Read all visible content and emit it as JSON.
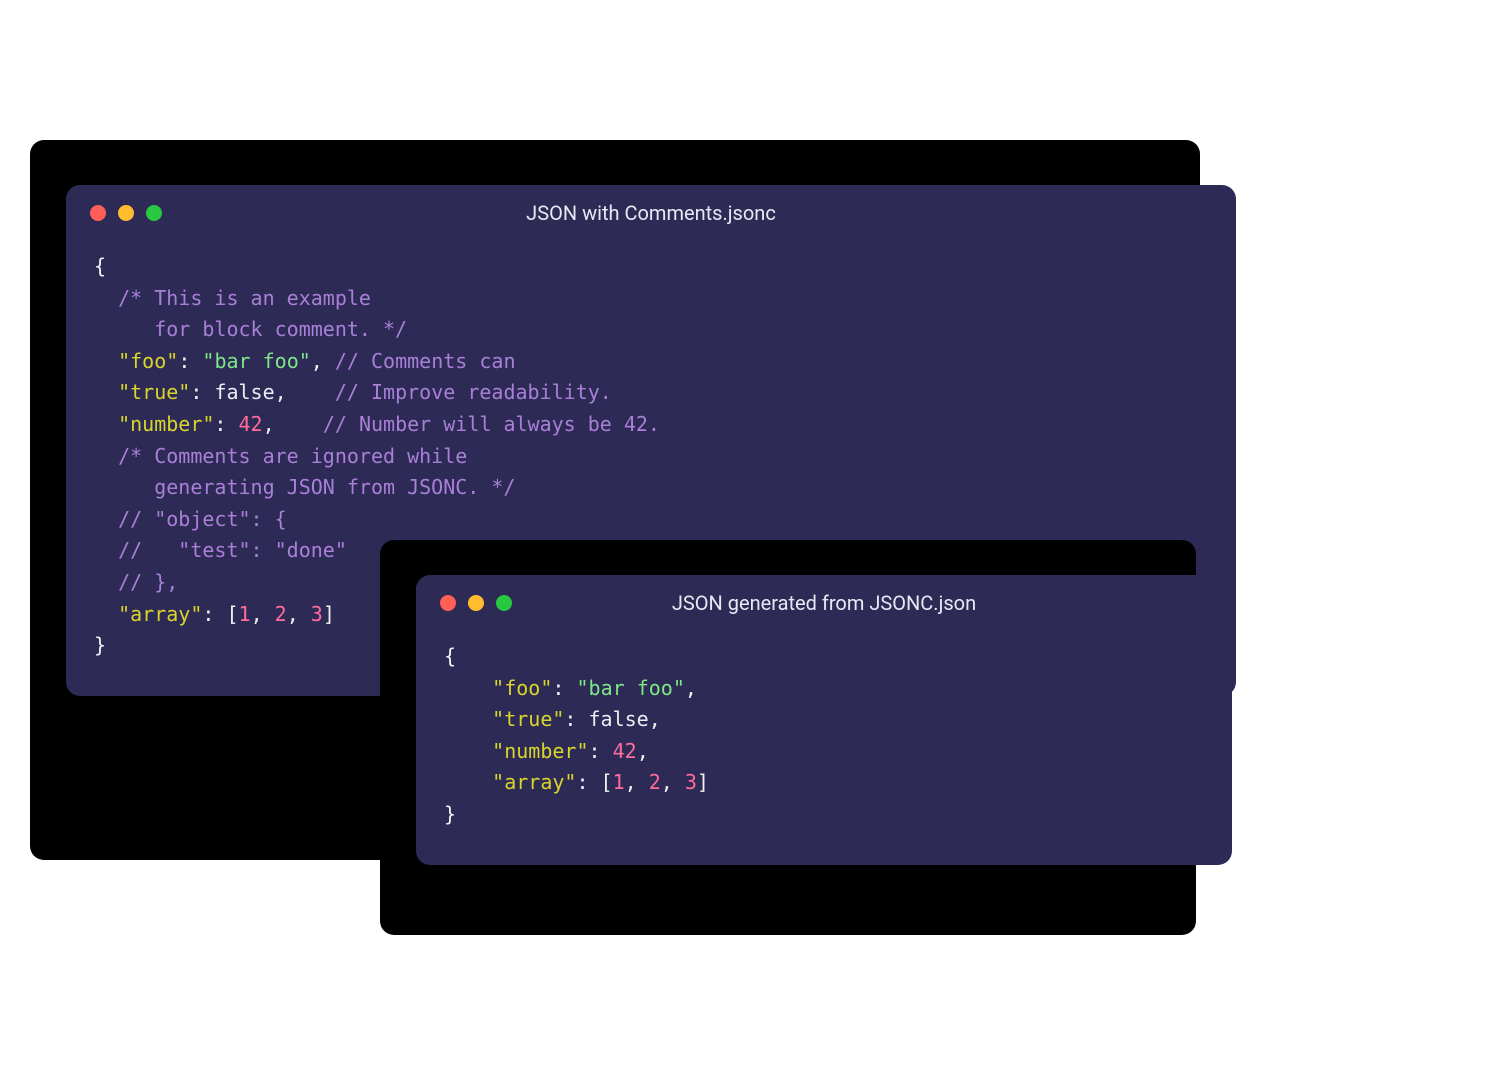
{
  "windows": {
    "front": {
      "title": "JSON with Comments.jsonc",
      "code": [
        [
          {
            "t": "punc",
            "v": "{"
          }
        ],
        [
          {
            "t": "pad",
            "v": "  "
          },
          {
            "t": "comment",
            "v": "/* This is an example"
          }
        ],
        [
          {
            "t": "pad",
            "v": "     "
          },
          {
            "t": "comment",
            "v": "for block comment. */"
          }
        ],
        [
          {
            "t": "pad",
            "v": "  "
          },
          {
            "t": "key",
            "v": "\"foo\""
          },
          {
            "t": "punc",
            "v": ": "
          },
          {
            "t": "string",
            "v": "\"bar foo\""
          },
          {
            "t": "punc",
            "v": ", "
          },
          {
            "t": "comment",
            "v": "// Comments can"
          }
        ],
        [
          {
            "t": "pad",
            "v": "  "
          },
          {
            "t": "key",
            "v": "\"true\""
          },
          {
            "t": "punc",
            "v": ": "
          },
          {
            "t": "bool",
            "v": "false"
          },
          {
            "t": "punc",
            "v": ",    "
          },
          {
            "t": "comment",
            "v": "// Improve readability."
          }
        ],
        [
          {
            "t": "pad",
            "v": "  "
          },
          {
            "t": "key",
            "v": "\"number\""
          },
          {
            "t": "punc",
            "v": ": "
          },
          {
            "t": "number",
            "v": "42"
          },
          {
            "t": "punc",
            "v": ",    "
          },
          {
            "t": "comment",
            "v": "// Number will always be 42."
          }
        ],
        [
          {
            "t": "pad",
            "v": "  "
          },
          {
            "t": "comment",
            "v": "/* Comments are ignored while"
          }
        ],
        [
          {
            "t": "pad",
            "v": "     "
          },
          {
            "t": "comment",
            "v": "generating JSON from JSONC. */"
          }
        ],
        [
          {
            "t": "pad",
            "v": "  "
          },
          {
            "t": "comment",
            "v": "// \"object\": {"
          }
        ],
        [
          {
            "t": "pad",
            "v": "  "
          },
          {
            "t": "comment",
            "v": "//   \"test\": \"done\""
          }
        ],
        [
          {
            "t": "pad",
            "v": "  "
          },
          {
            "t": "comment",
            "v": "// },"
          }
        ],
        [
          {
            "t": "pad",
            "v": "  "
          },
          {
            "t": "key",
            "v": "\"array\""
          },
          {
            "t": "punc",
            "v": ": ["
          },
          {
            "t": "number",
            "v": "1"
          },
          {
            "t": "punc",
            "v": ", "
          },
          {
            "t": "number",
            "v": "2"
          },
          {
            "t": "punc",
            "v": ", "
          },
          {
            "t": "number",
            "v": "3"
          },
          {
            "t": "punc",
            "v": "]"
          }
        ],
        [
          {
            "t": "punc",
            "v": "}"
          }
        ]
      ]
    },
    "back": {
      "title": "JSON generated from JSONC.json",
      "code": [
        [
          {
            "t": "punc",
            "v": "{"
          }
        ],
        [
          {
            "t": "pad",
            "v": "    "
          },
          {
            "t": "key",
            "v": "\"foo\""
          },
          {
            "t": "punc",
            "v": ": "
          },
          {
            "t": "string",
            "v": "\"bar foo\""
          },
          {
            "t": "punc",
            "v": ","
          }
        ],
        [
          {
            "t": "pad",
            "v": "    "
          },
          {
            "t": "key",
            "v": "\"true\""
          },
          {
            "t": "punc",
            "v": ": "
          },
          {
            "t": "bool",
            "v": "false"
          },
          {
            "t": "punc",
            "v": ","
          }
        ],
        [
          {
            "t": "pad",
            "v": "    "
          },
          {
            "t": "key",
            "v": "\"number\""
          },
          {
            "t": "punc",
            "v": ": "
          },
          {
            "t": "number",
            "v": "42"
          },
          {
            "t": "punc",
            "v": ","
          }
        ],
        [
          {
            "t": "pad",
            "v": "    "
          },
          {
            "t": "key",
            "v": "\"array\""
          },
          {
            "t": "punc",
            "v": ": ["
          },
          {
            "t": "number",
            "v": "1"
          },
          {
            "t": "punc",
            "v": ", "
          },
          {
            "t": "number",
            "v": "2"
          },
          {
            "t": "punc",
            "v": ", "
          },
          {
            "t": "number",
            "v": "3"
          },
          {
            "t": "punc",
            "v": "]"
          }
        ],
        [
          {
            "t": "punc",
            "v": "}"
          }
        ]
      ]
    }
  },
  "colors": {
    "window_bg": "#2d2b55",
    "dot_red": "#ff5f57",
    "dot_yellow": "#febc2e",
    "dot_green": "#28c840"
  }
}
